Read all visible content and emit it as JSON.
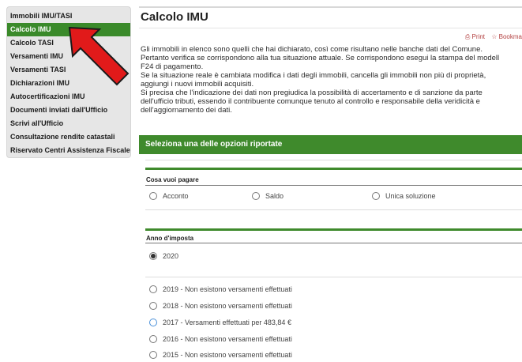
{
  "sidebar": {
    "items": [
      {
        "label": "Immobili IMU/TASI",
        "active": false
      },
      {
        "label": "Calcolo IMU",
        "active": true
      },
      {
        "label": "Calcolo TASI",
        "active": false
      },
      {
        "label": "Versamenti IMU",
        "active": false
      },
      {
        "label": "Versamenti TASI",
        "active": false
      },
      {
        "label": "Dichiarazioni IMU",
        "active": false
      },
      {
        "label": "Autocertificazioni IMU",
        "active": false
      },
      {
        "label": "Documenti inviati dall'Ufficio",
        "active": false
      },
      {
        "label": "Scrivi all'Ufficio",
        "active": false
      },
      {
        "label": "Consultazione rendite catastali",
        "active": false
      },
      {
        "label": "Riservato Centri Assistenza Fiscale",
        "active": false
      }
    ]
  },
  "page": {
    "title": "Calcolo IMU",
    "print_label": "Print",
    "bookmark_label": "Bookma",
    "intro": [
      "Gli immobili in elenco sono quelli che hai dichiarato, così come risultano nelle banche dati del Comune.",
      "Pertanto verifica se corrispondono alla tua situazione attuale. Se corrispondono esegui la stampa del modell",
      "F24 di pagamento.",
      "Se la situazione reale è cambiata modifica i dati degli immobili, cancella gli immobili non più di proprietà,",
      "aggiungi i nuovi immobili acquisiti.",
      "Si precisa che l'indicazione dei dati non pregiudica la possibilità di accertamento e di sanzione da parte",
      "dell'ufficio tributi, essendo il contribuente comunque tenuto al controllo e responsabile della veridicità e",
      "dell'aggiornamento dei dati."
    ]
  },
  "options": {
    "section_title": "Seleziona una delle opzioni riportate",
    "pay_label": "Cosa vuoi pagare",
    "pay_choices": [
      "Acconto",
      "Saldo",
      "Unica soluzione"
    ],
    "year_label": "Anno d'imposta",
    "year_selected": "2020",
    "year_choices": [
      "2019 - Non esistono versamenti effettuati",
      "2018 - Non esistono versamenti effettuati",
      "2017 - Versamenti effettuati per 483,84 €",
      "2016 - Non esistono versamenti effettuati",
      "2015 - Non esistono versamenti effettuati"
    ]
  },
  "colors": {
    "accent_green": "#3f8a2c",
    "arrow_red": "#e11a1a"
  }
}
